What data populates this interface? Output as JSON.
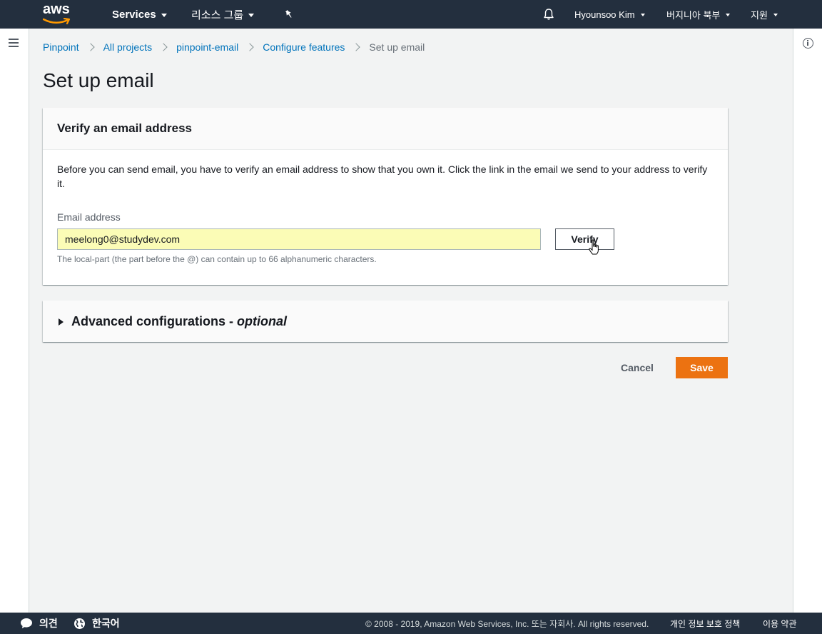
{
  "topnav": {
    "logo_text": "aws",
    "services_label": "Services",
    "resource_groups_label": "리소스 그룹",
    "user_label": "Hyounsoo Kim",
    "region_label": "버지니아 북부",
    "support_label": "지원"
  },
  "breadcrumb": {
    "items": [
      "Pinpoint",
      "All projects",
      "pinpoint-email",
      "Configure features"
    ],
    "current": "Set up email"
  },
  "page": {
    "title": "Set up email"
  },
  "verify_panel": {
    "heading": "Verify an email address",
    "description": "Before you can send email, you have to verify an email address to show that you own it. Click the link in the email we send to your address to verify it.",
    "field_label": "Email address",
    "email_value": "meelong0@studydev.com",
    "verify_button": "Verify",
    "hint": "The local-part (the part before the @) can contain up to 66 alphanumeric characters."
  },
  "advanced": {
    "label": "Advanced configurations - ",
    "optional": "optional"
  },
  "actions": {
    "cancel": "Cancel",
    "save": "Save"
  },
  "footer": {
    "feedback": "의견",
    "language": "한국어",
    "copyright": "© 2008 - 2019, Amazon Web Services, Inc. 또는 자회사. All rights reserved.",
    "privacy": "개인 정보 보호 정책",
    "terms": "이용 약관"
  },
  "colors": {
    "nav_bg": "#232f3e",
    "link": "#0073bb",
    "primary": "#ec7211",
    "autofill": "#fbfcb6"
  }
}
